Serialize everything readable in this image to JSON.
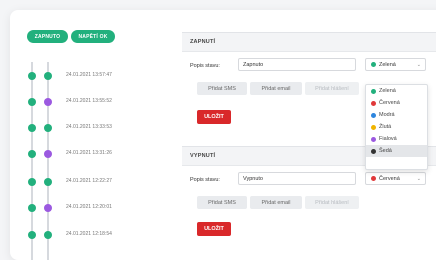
{
  "timeline": {
    "pills": [
      "ZAPNUTO",
      "NAPĚTÍ OK"
    ],
    "colors": {
      "green": "#22b07d",
      "purple": "#9b59e0",
      "line": "#d6d9de"
    },
    "rows": [
      {
        "time": "24.01.2021 13:57:47",
        "dots": [
          "green",
          "green"
        ]
      },
      {
        "time": "24.01.2021 13:55:52",
        "dots": [
          "green",
          "purple"
        ]
      },
      {
        "time": "24.01.2021 13:33:53",
        "dots": [
          "green",
          "green"
        ]
      },
      {
        "time": "24.01.2021 13:31:26",
        "dots": [
          "green",
          "purple"
        ]
      },
      {
        "time": "24.01.2021 12:22:27",
        "dots": [
          "green",
          "green"
        ]
      },
      {
        "time": "24.01.2021 12:20:01",
        "dots": [
          "green",
          "purple"
        ]
      },
      {
        "time": "24.01.2021 12:18:54",
        "dots": [
          "green",
          "green"
        ]
      }
    ]
  },
  "sections": [
    {
      "header": "ZAPNUTÍ",
      "label": "Popis stavu:",
      "value": "Zapnuto",
      "select_value": "Zelená",
      "select_color": "#22b07d",
      "buttons": [
        "Přidat SMS",
        "Přidat email",
        "Přidat hlášení"
      ],
      "save": "ULOŽIT"
    },
    {
      "header": "VYPNUTÍ",
      "label": "Popis stavu:",
      "value": "Vypnuto",
      "select_value": "Červená",
      "select_color": "#e0383a",
      "buttons": [
        "Přidat SMS",
        "Přidat email",
        "Přidat hlášení"
      ],
      "save": "ULOŽIT"
    }
  ],
  "dropdown": {
    "options": [
      {
        "label": "Zelená",
        "color": "#22b07d"
      },
      {
        "label": "Červená",
        "color": "#e0383a"
      },
      {
        "label": "Modrá",
        "color": "#2e86de"
      },
      {
        "label": "Žlutá",
        "color": "#f0b400"
      },
      {
        "label": "Fialová",
        "color": "#9b59e0"
      },
      {
        "label": "Šedá",
        "color": "#333333",
        "selected": true
      }
    ]
  }
}
